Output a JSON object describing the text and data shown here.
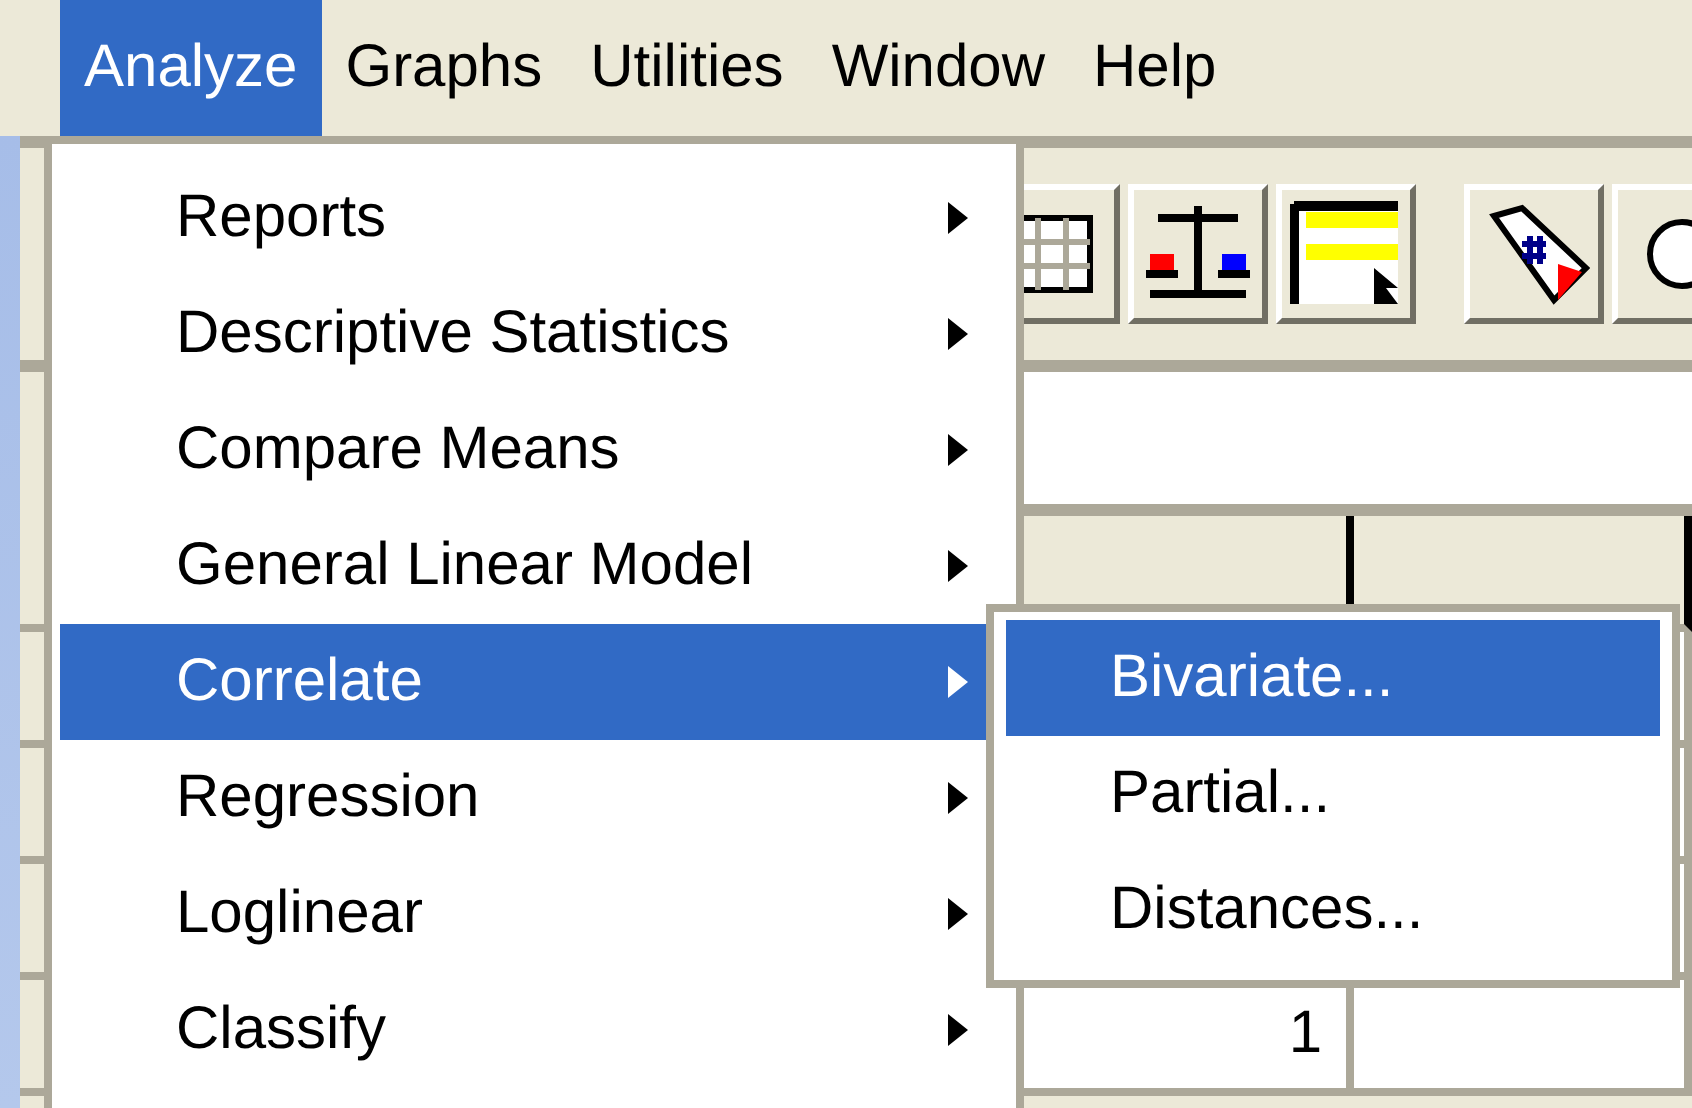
{
  "menubar": [
    {
      "label": "Analyze",
      "selected": true
    },
    {
      "label": "Graphs",
      "selected": false
    },
    {
      "label": "Utilities",
      "selected": false
    },
    {
      "label": "Window",
      "selected": false
    },
    {
      "label": "Help",
      "selected": false
    }
  ],
  "menu": {
    "items": [
      {
        "label": "Reports",
        "submenu": true,
        "selected": false
      },
      {
        "label": "Descriptive Statistics",
        "submenu": true,
        "selected": false
      },
      {
        "label": "Compare Means",
        "submenu": true,
        "selected": false
      },
      {
        "label": "General Linear Model",
        "submenu": true,
        "selected": false
      },
      {
        "label": "Correlate",
        "submenu": true,
        "selected": true
      },
      {
        "label": "Regression",
        "submenu": true,
        "selected": false
      },
      {
        "label": "Loglinear",
        "submenu": true,
        "selected": false
      },
      {
        "label": "Classify",
        "submenu": true,
        "selected": false
      }
    ]
  },
  "submenu": {
    "items": [
      {
        "label": "Bivariate...",
        "selected": true
      },
      {
        "label": "Partial...",
        "selected": false
      },
      {
        "label": "Distances...",
        "selected": false
      }
    ]
  },
  "data_view": {
    "cells": [
      "1"
    ]
  }
}
